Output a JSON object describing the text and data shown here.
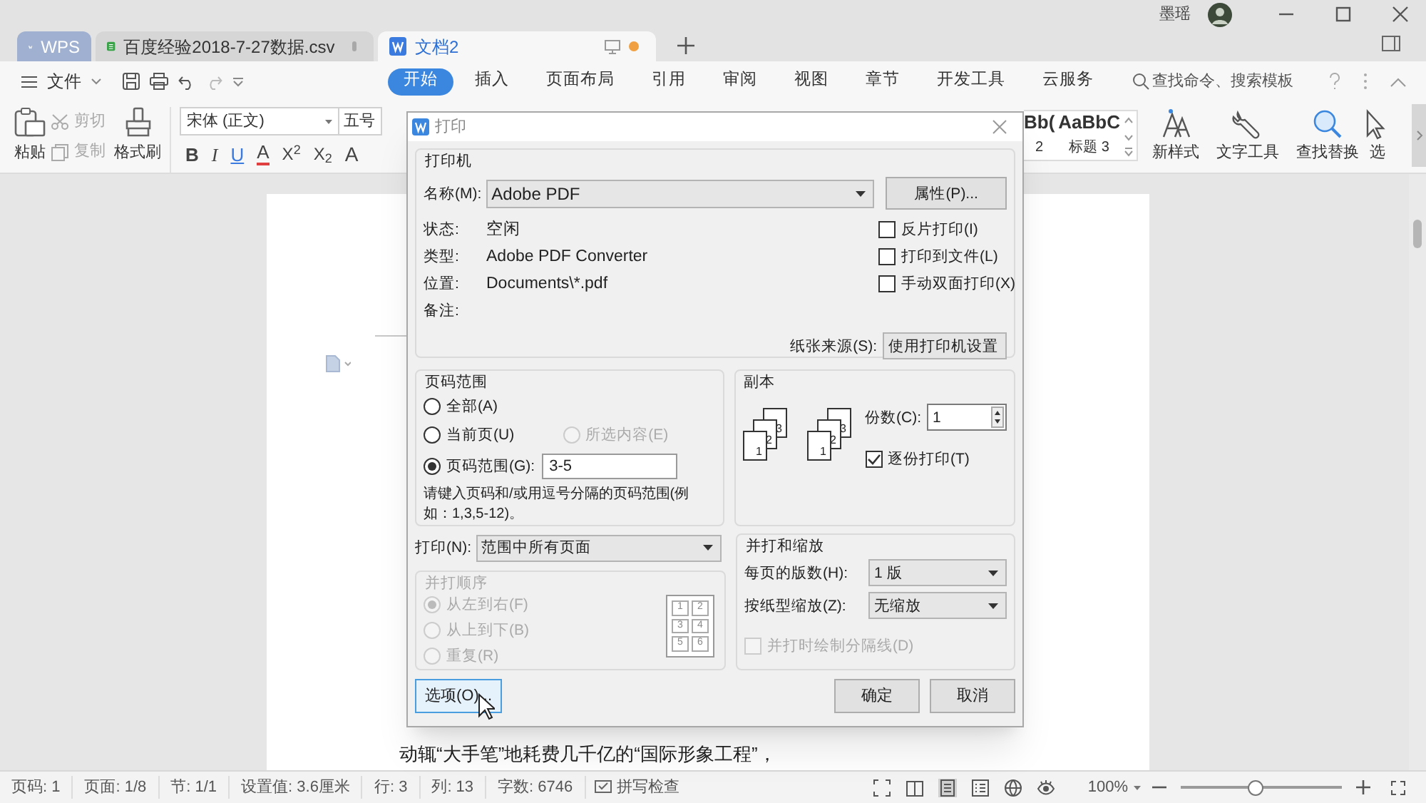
{
  "title_bar": {
    "user": "墨瑶"
  },
  "doc_tabs": [
    {
      "label": "WPS",
      "kind": "home",
      "selected": false
    },
    {
      "label": "百度经验2018-7-27数据.csv",
      "kind": "sheet",
      "selected": false,
      "modified": false
    },
    {
      "label": "文档2",
      "kind": "writer",
      "selected": true,
      "modified": true
    }
  ],
  "menu": {
    "file": "文件"
  },
  "ribbon_tabs": [
    {
      "label": "开始",
      "selected": true
    },
    {
      "label": "插入",
      "selected": false
    },
    {
      "label": "页面布局",
      "selected": false
    },
    {
      "label": "引用",
      "selected": false
    },
    {
      "label": "审阅",
      "selected": false
    },
    {
      "label": "视图",
      "selected": false
    },
    {
      "label": "章节",
      "selected": false
    },
    {
      "label": "开发工具",
      "selected": false
    },
    {
      "label": "云服务",
      "selected": false
    }
  ],
  "search": {
    "placeholder": "查找命令、搜索模板"
  },
  "toolbar": {
    "paste": "粘贴",
    "cut": "剪切",
    "copy": "复制",
    "format_painter": "格式刷",
    "font": "宋体 (正文)",
    "size": "五号",
    "format_buttons": [
      {
        "kind": "bold",
        "label": "B"
      },
      {
        "kind": "italic",
        "label": "I"
      },
      {
        "kind": "underline",
        "label": "U"
      },
      {
        "kind": "font_color",
        "label": "A"
      },
      {
        "kind": "superscript",
        "label": "X$^{2}$"
      },
      {
        "kind": "subscript",
        "label": "X$_{2}$"
      },
      {
        "kind": "effect",
        "label": "A"
      }
    ],
    "styles": [
      {
        "preview": "Bb(",
        "label": "2"
      },
      {
        "preview": "AaBbC",
        "label": "标题 3"
      }
    ],
    "tools": [
      {
        "kind": "new_style",
        "label": "新样式"
      },
      {
        "kind": "text_tools",
        "label": "文字工具"
      },
      {
        "kind": "find_replace",
        "label": "查找替换"
      },
      {
        "kind": "select",
        "label": "选"
      }
    ]
  },
  "document": {
    "line": "动辄“大手笔”地耗费几千亿的“国际形象工程”，"
  },
  "print_dialog": {
    "title": "打印",
    "printer": {
      "legend": "打印机",
      "name_label": "名称(M):",
      "name": "Adobe PDF",
      "properties_button": "属性(P)...",
      "info": [
        {
          "label": "状态:",
          "value": "空闲"
        },
        {
          "label": "类型:",
          "value": "Adobe PDF Converter"
        },
        {
          "label": "位置:",
          "value": "Documents\\*.pdf"
        },
        {
          "label": "备注:"
        }
      ],
      "options": [
        {
          "label": "反片打印(I)",
          "checked": false
        },
        {
          "label": "打印到文件(L)",
          "checked": false
        },
        {
          "label": "手动双面打印(X)",
          "checked": false
        }
      ],
      "paper_source_label": "纸张来源(S):",
      "paper_source": "使用打印机设置"
    },
    "page_range": {
      "legend": "页码范围",
      "options": [
        {
          "label": "全部(A)",
          "selected": false,
          "disabled": false
        },
        {
          "label": "当前页(U)",
          "selected": false,
          "disabled": false
        },
        {
          "label": "所选内容(E)",
          "selected": false,
          "disabled": true
        },
        {
          "label": "页码范围(G):",
          "selected": true,
          "disabled": false
        }
      ],
      "range_value": "3-5",
      "hint": "请键入页码和/或用逗号分隔的页码范围(例如：1,3,5-12)。"
    },
    "copies": {
      "legend": "副本",
      "count_label": "份数(C):",
      "count": "1",
      "collate_label": "逐份打印(T)",
      "collate": true,
      "stacks": [
        [
          "1",
          "2",
          "3"
        ],
        [
          "1",
          "2",
          "3"
        ]
      ]
    },
    "print_what": {
      "label": "打印(N):",
      "value": "范围中所有页面"
    },
    "order": {
      "legend": "并打顺序",
      "disabled": true,
      "options": [
        {
          "label": "从左到右(F)",
          "selected": true
        },
        {
          "label": "从上到下(B)",
          "selected": false
        },
        {
          "label": "重复(R)",
          "selected": false
        }
      ],
      "grid": [
        "1",
        "2",
        "3",
        "4",
        "5",
        "6"
      ]
    },
    "scale": {
      "legend": "并打和缩放",
      "pages_per_sheet_label": "每页的版数(H):",
      "pages_per_sheet": "1 版",
      "scale_label": "按纸型缩放(Z):",
      "scale": "无缩放",
      "divider_label": "并打时绘制分隔线(D)",
      "divider_checked": false,
      "divider_disabled": true
    },
    "buttons": [
      {
        "label": "选项(O)...",
        "kind": "options",
        "focused": true
      },
      {
        "label": "确定",
        "kind": "ok",
        "focused": false
      },
      {
        "label": "取消",
        "kind": "cancel",
        "focused": false
      }
    ]
  },
  "status_bar": {
    "items": [
      "页码: 1",
      "页面: 1/8",
      "节: 1/1",
      "设置值: 3.6厘米",
      "行: 3",
      "列: 13",
      "字数: 6746"
    ],
    "spell": "拼写检查",
    "zoom": "100%",
    "zoom_slider": {
      "level": 0.46
    }
  }
}
